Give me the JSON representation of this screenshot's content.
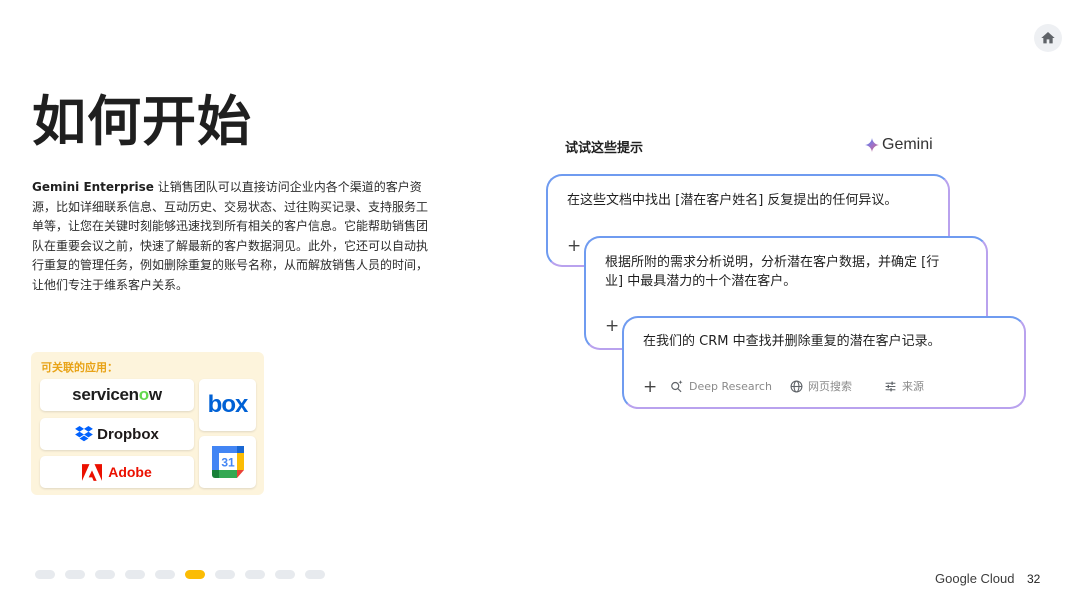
{
  "slide": {
    "title": "如何开始",
    "description_brand": "Gemini Enterprise",
    "description_body": " 让销售团队可以直接访问企业内各个渠道的客户资源，比如详细联系信息、互动历史、交易状态、过往购买记录、支持服务工单等，让您在关键时刻能够迅速找到所有相关的客户信息。它能帮助销售团队在重要会议之前，快速了解最新的客户数据洞见。此外，它还可以自动执行重复的管理任务，例如删除重复的账号名称，从而解放销售人员的时间，让他们专注于维系客户关系。",
    "page_number": "32"
  },
  "apps": {
    "label": "可关联的应用：",
    "servicenow": "servicenow",
    "box": "box",
    "dropbox": "Dropbox",
    "adobe": "Adobe",
    "calendar_day": "31"
  },
  "prompts": {
    "heading": "试试这些提示",
    "brand": "Gemini",
    "items": [
      "在这些文档中找出 [潜在客户姓名] 反复提出的任何异议。",
      "根据所附的需求分析说明，分析潜在客户数据，并确定 [行业] 中最具潜力的十个潜在客户。",
      "在我们的 CRM 中查找并删除重复的潜在客户记录。"
    ],
    "plus": "+",
    "tools": {
      "deep_research": "Deep Research",
      "web_search": "网页搜索",
      "sources": "来源"
    }
  },
  "footer": {
    "brand": "Google Cloud",
    "dots_count": 10,
    "active_dot": 6
  },
  "colors": {
    "accent_yellow": "#fbbc04",
    "apps_panel_bg": "#fdf4dc",
    "apps_label": "#e8a317",
    "card_border_blue": "#6f9bf0",
    "card_border_purple": "#b9a2ee"
  }
}
